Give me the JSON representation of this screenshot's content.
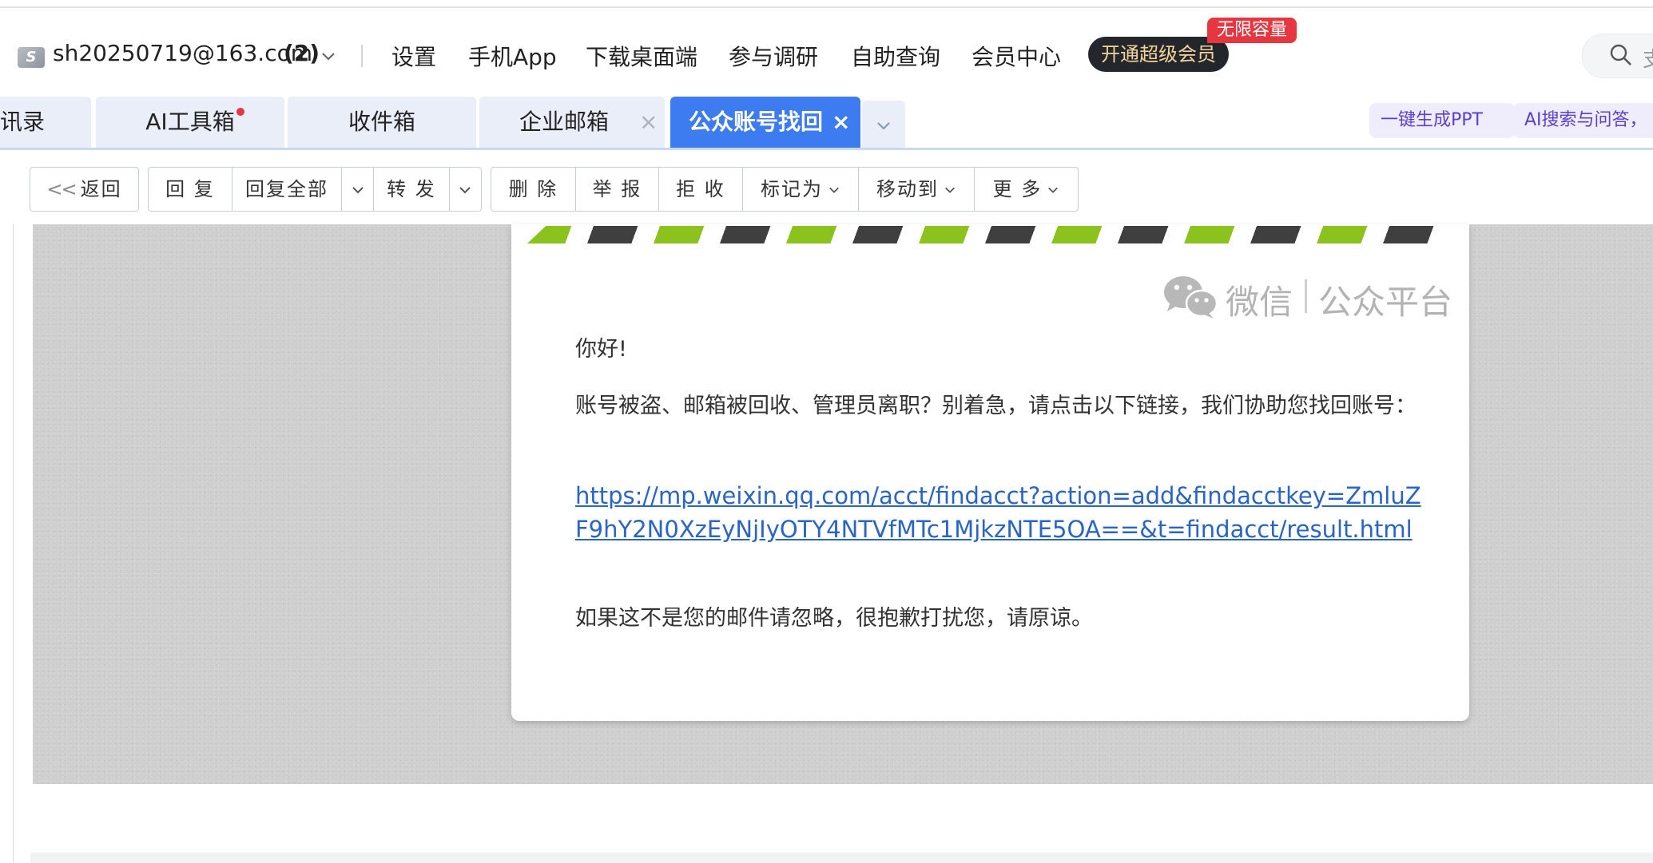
{
  "header": {
    "account_icon_letter": "S",
    "account_email": "sh20250719@163.com",
    "account_count": "(2)",
    "nav": [
      "设置",
      "手机App",
      "下载桌面端",
      "参与调研",
      "自助查询",
      "会员中心"
    ],
    "vip_button": "开通超级会员",
    "vip_badge": "无限容量",
    "search_placeholder_visible": "支"
  },
  "tabs": {
    "items": [
      {
        "label": "讯录",
        "active": false
      },
      {
        "label": "AI工具箱",
        "active": false,
        "has_dot": true
      },
      {
        "label": "收件箱",
        "active": false
      },
      {
        "label": "企业邮箱",
        "active": false,
        "closable": true
      },
      {
        "label": "公众账号找回",
        "active": true,
        "closable": true
      }
    ],
    "close_glyph": "×",
    "quick_actions": [
      "一键生成PPT",
      "AI搜索与问答，"
    ]
  },
  "toolbar": {
    "back": "返回",
    "reply": "回 复",
    "reply_all": "回复全部",
    "forward": "转 发",
    "delete": "删 除",
    "report": "举 报",
    "reject": "拒 收",
    "mark_as": "标记为",
    "move_to": "移动到",
    "more": "更 多",
    "back_glyph": "<<"
  },
  "mail": {
    "brand": "微信",
    "platform": "公众平台",
    "greeting": "你好!",
    "body": "账号被盗、邮箱被回收、管理员离职？别着急，请点击以下链接，我们协助您找回账号：",
    "link": "https://mp.weixin.qq.com/acct/findacct?action=add&findacctkey=ZmluZF9hY2N0XzEyNjIyOTY4NTVfMTc1MjkzNTE5OA==&t=findacct/result.html",
    "closing": "如果这不是您的邮件请忽略，很抱歉打扰您，请原谅。"
  },
  "colors": {
    "tab_active": "#3d7bf0",
    "link": "#2a64c6",
    "vip_bg": "#23272c",
    "badge_red": "#e6363f",
    "stripe_green": "#8bc21e",
    "stripe_dark": "#3f3f3f"
  }
}
